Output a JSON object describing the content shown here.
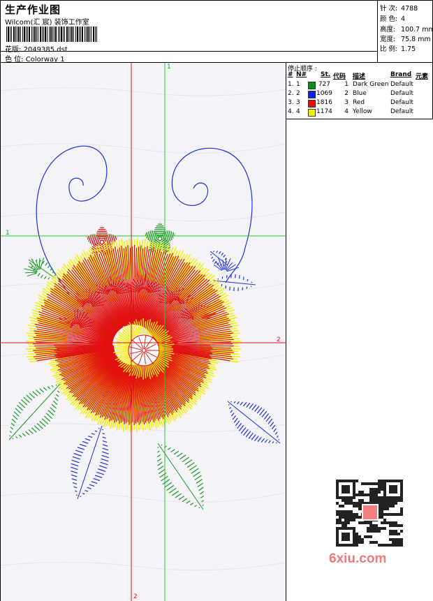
{
  "header": {
    "title": "生产作业图",
    "company": "Wilcom(汇 宸) 装饰工作室",
    "design_label": "花版:",
    "design_value": "2049385.dst",
    "colorway_label": "色 位:",
    "colorway_value": "Colorway 1"
  },
  "stats": [
    {
      "label": "针 次:",
      "value": "4788"
    },
    {
      "label": "颜 色:",
      "value": "4"
    },
    {
      "label": "高度:",
      "value": "100.7 mm"
    },
    {
      "label": "宽度:",
      "value": "75.8 mm"
    },
    {
      "label": "比 例:",
      "value": "1.75"
    }
  ],
  "stop_sequence": {
    "title": "停止顺序 :",
    "headers": [
      "#",
      "N#",
      "St.",
      "代码",
      "描述",
      "Brand",
      "元素"
    ],
    "rows": [
      {
        "idx": "1.",
        "n": "1",
        "color": "#0e8a1a",
        "stitches": "727",
        "code": "1",
        "desc": "Dark Green",
        "brand": "Default"
      },
      {
        "idx": "2.",
        "n": "2",
        "color": "#1020e0",
        "stitches": "1069",
        "code": "2",
        "desc": "Blue",
        "brand": "Default"
      },
      {
        "idx": "3.",
        "n": "3",
        "color": "#e01010",
        "stitches": "1816",
        "code": "3",
        "desc": "Red",
        "brand": "Default"
      },
      {
        "idx": "4.",
        "n": "4",
        "color": "#f0f000",
        "stitches": "1174",
        "code": "4",
        "desc": "Yellow",
        "brand": "Default"
      }
    ]
  },
  "guides": {
    "green_v_label": "1",
    "green_h_label": "1",
    "red_h_label": "2",
    "red_v_label": "2"
  },
  "watermark": "6xiu.com",
  "colors": {
    "guide_green": "#22cc22",
    "guide_red": "#e01010",
    "canvas_bg": "#f4f3f8"
  }
}
